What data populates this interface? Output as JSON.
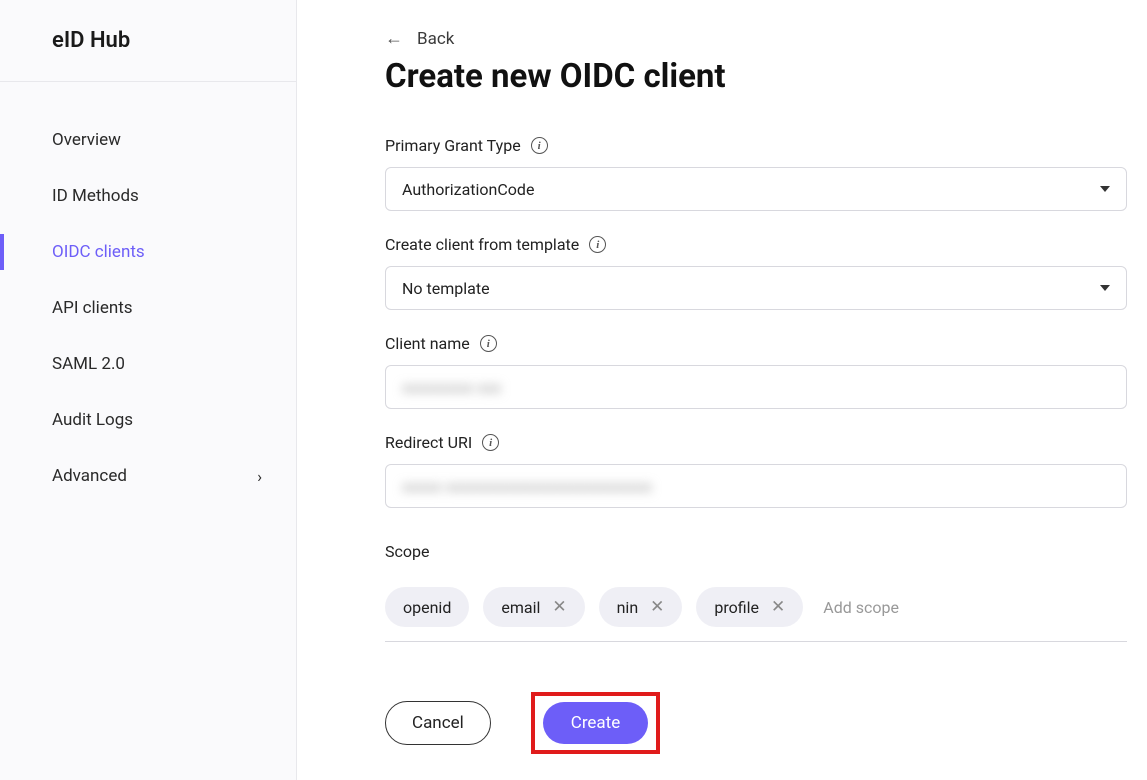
{
  "brand": "eID Hub",
  "sidebar": {
    "items": [
      {
        "label": "Overview"
      },
      {
        "label": "ID Methods"
      },
      {
        "label": "OIDC clients"
      },
      {
        "label": "API clients"
      },
      {
        "label": "SAML 2.0"
      },
      {
        "label": "Audit Logs"
      },
      {
        "label": "Advanced"
      }
    ]
  },
  "back_label": "Back",
  "page_title": "Create new OIDC client",
  "form": {
    "grant_type": {
      "label": "Primary Grant Type",
      "value": "AuthorizationCode"
    },
    "template": {
      "label": "Create client from template",
      "value": "No template"
    },
    "client_name": {
      "label": "Client name",
      "value": "xxxxxxxxx xxx"
    },
    "redirect_uri": {
      "label": "Redirect URI",
      "value": "xxxxx xxxxxxxxxxxxxxxxxxxxxxxxxx"
    },
    "scope": {
      "label": "Scope",
      "chips": [
        "openid",
        "email",
        "nin",
        "profile"
      ],
      "add_placeholder": "Add scope"
    }
  },
  "buttons": {
    "cancel": "Cancel",
    "create": "Create"
  }
}
